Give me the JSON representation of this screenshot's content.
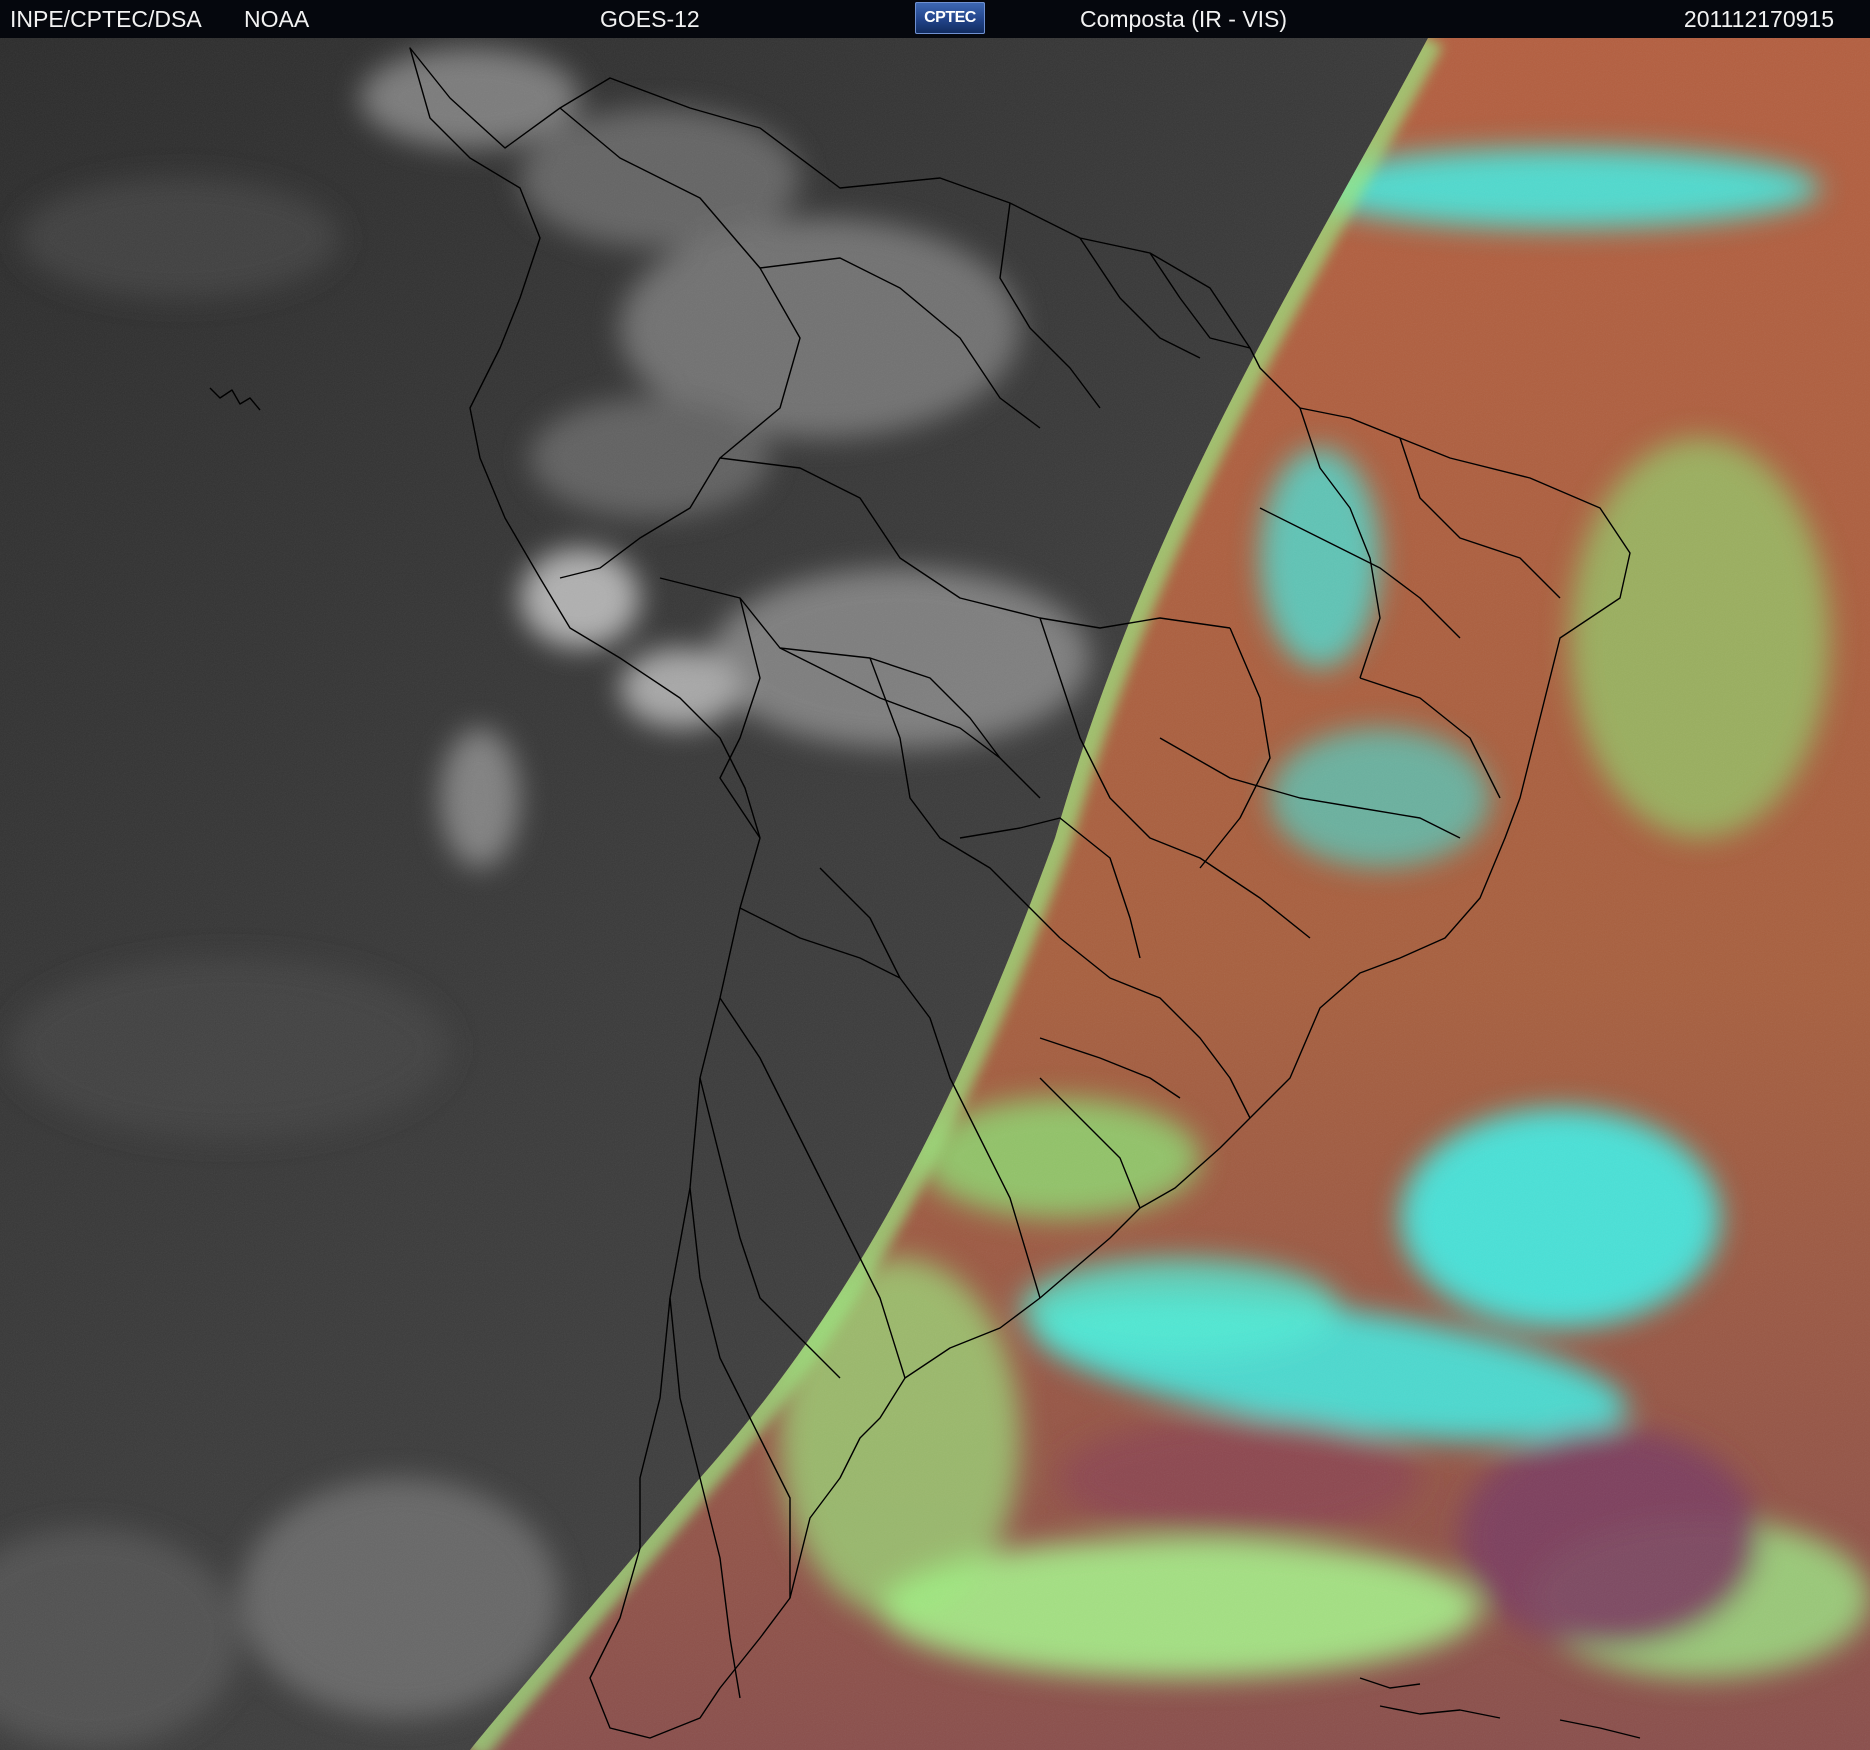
{
  "header": {
    "agency": "INPE/CPTEC/DSA",
    "partner": "NOAA",
    "satellite": "GOES-12",
    "logo_text": "CPTEC",
    "product": "Composta (IR - VIS)",
    "timestamp": "201112170915"
  },
  "image": {
    "left_half": "infrared grayscale (night side)",
    "right_half": "visible false-color composite (day side)",
    "colors": {
      "ir_background": "#3a3a3a",
      "vis_land": "#b06445",
      "vis_cloud_low": "#8cf07a",
      "vis_cloud_high": "#40f0e8",
      "vis_ocean_dark": "#7c3d60",
      "boundary_lines": "#000000"
    }
  }
}
